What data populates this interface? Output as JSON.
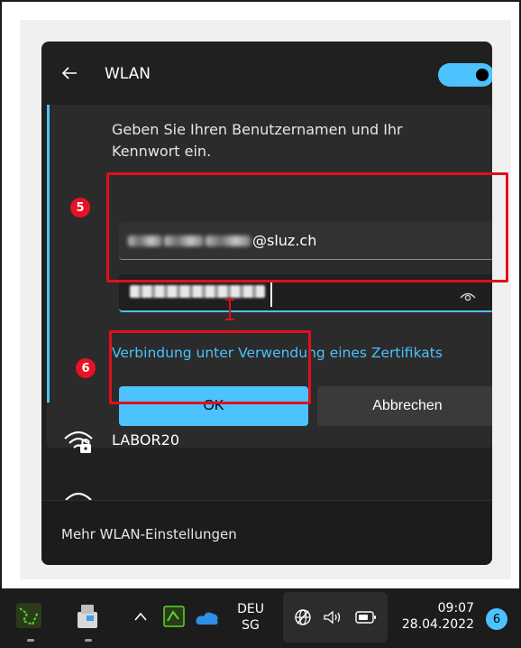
{
  "flyout": {
    "header": {
      "title": "WLAN",
      "toggle_state": "on"
    },
    "auth": {
      "instruction": "Geben Sie Ihren Benutzernamen und Ihr Kennwort ein.",
      "username_suffix": "@sluz.ch",
      "certificate_link": "Verbindung unter Verwendung eines Zertifikats",
      "ok_label": "OK",
      "cancel_label": "Abbrechen"
    },
    "network": {
      "name": "LABOR20"
    },
    "footer": {
      "settings_label": "Mehr WLAN-Einstellungen"
    }
  },
  "annotations": {
    "step_credentials": "5",
    "step_ok": "6"
  },
  "taskbar": {
    "language_code": "DEU",
    "language_region": "SG",
    "time": "09:07",
    "date": "28.04.2022",
    "notification_count": "6"
  },
  "colors": {
    "accent": "#4cc2ff",
    "annotation_red": "#e0101a",
    "flyout_bg": "#202020"
  }
}
